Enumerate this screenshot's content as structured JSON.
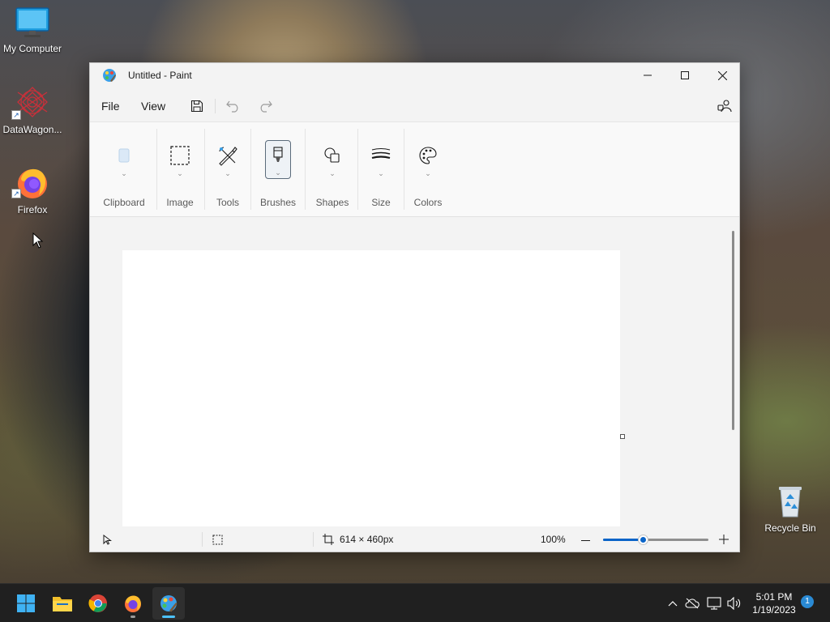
{
  "desktop": {
    "icons": [
      {
        "label": "My Computer",
        "icon": "monitor-icon"
      },
      {
        "label": "DataWagon...",
        "icon": "datawagon-icon"
      },
      {
        "label": "Firefox",
        "icon": "firefox-icon"
      },
      {
        "label": "Recycle Bin",
        "icon": "recycle-bin-icon"
      }
    ]
  },
  "paint": {
    "title": "Untitled - Paint",
    "menu": {
      "file": "File",
      "view": "View"
    },
    "ribbon": {
      "groups": [
        {
          "label": "Clipboard",
          "icon": "clipboard-icon"
        },
        {
          "label": "Image",
          "icon": "selection-icon"
        },
        {
          "label": "Tools",
          "icon": "tools-icon"
        },
        {
          "label": "Brushes",
          "icon": "brush-icon",
          "selected": true
        },
        {
          "label": "Shapes",
          "icon": "shapes-icon"
        },
        {
          "label": "Size",
          "icon": "line-size-icon"
        },
        {
          "label": "Colors",
          "icon": "palette-icon"
        }
      ]
    },
    "status": {
      "canvas_size": "614 × 460px",
      "zoom": "100%",
      "zoom_slider_fraction": 0.38
    }
  },
  "taskbar": {
    "apps": [
      "start-icon",
      "file-explorer-icon",
      "chrome-icon",
      "firefox-icon",
      "paint-icon"
    ],
    "active_app": "paint-icon",
    "clock": {
      "time": "5:01 PM",
      "date": "1/19/2023"
    },
    "notifications": "1"
  },
  "colors": {
    "accent": "#0a64c8",
    "taskbar": "#202020",
    "window": "#f3f3f3"
  }
}
